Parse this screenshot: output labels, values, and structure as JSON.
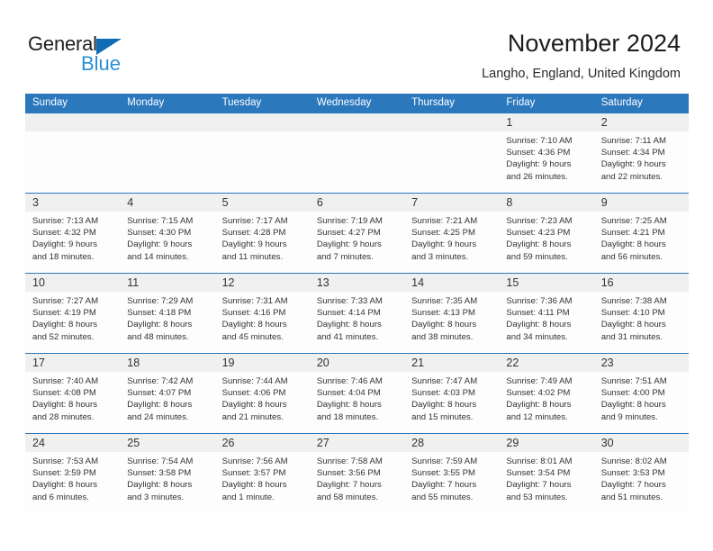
{
  "brand": {
    "name_dark": "General",
    "name_blue": "Blue",
    "dark_color": "#231f20",
    "blue_color": "#2a8fd4",
    "triangle_color": "#0f6cb5"
  },
  "header": {
    "title": "November 2024",
    "subtitle": "Langho, England, United Kingdom"
  },
  "theme": {
    "header_bg": "#2b78bd",
    "daynum_bg": "#f0f0f0",
    "cell_bg": "#fdfdfd",
    "rule_color": "#2b78bd"
  },
  "weekdays": [
    "Sunday",
    "Monday",
    "Tuesday",
    "Wednesday",
    "Thursday",
    "Friday",
    "Saturday"
  ],
  "weeks": [
    [
      {
        "day": "",
        "sunrise": "",
        "sunset": "",
        "daylight1": "",
        "daylight2": ""
      },
      {
        "day": "",
        "sunrise": "",
        "sunset": "",
        "daylight1": "",
        "daylight2": ""
      },
      {
        "day": "",
        "sunrise": "",
        "sunset": "",
        "daylight1": "",
        "daylight2": ""
      },
      {
        "day": "",
        "sunrise": "",
        "sunset": "",
        "daylight1": "",
        "daylight2": ""
      },
      {
        "day": "",
        "sunrise": "",
        "sunset": "",
        "daylight1": "",
        "daylight2": ""
      },
      {
        "day": "1",
        "sunrise": "Sunrise: 7:10 AM",
        "sunset": "Sunset: 4:36 PM",
        "daylight1": "Daylight: 9 hours",
        "daylight2": "and 26 minutes."
      },
      {
        "day": "2",
        "sunrise": "Sunrise: 7:11 AM",
        "sunset": "Sunset: 4:34 PM",
        "daylight1": "Daylight: 9 hours",
        "daylight2": "and 22 minutes."
      }
    ],
    [
      {
        "day": "3",
        "sunrise": "Sunrise: 7:13 AM",
        "sunset": "Sunset: 4:32 PM",
        "daylight1": "Daylight: 9 hours",
        "daylight2": "and 18 minutes."
      },
      {
        "day": "4",
        "sunrise": "Sunrise: 7:15 AM",
        "sunset": "Sunset: 4:30 PM",
        "daylight1": "Daylight: 9 hours",
        "daylight2": "and 14 minutes."
      },
      {
        "day": "5",
        "sunrise": "Sunrise: 7:17 AM",
        "sunset": "Sunset: 4:28 PM",
        "daylight1": "Daylight: 9 hours",
        "daylight2": "and 11 minutes."
      },
      {
        "day": "6",
        "sunrise": "Sunrise: 7:19 AM",
        "sunset": "Sunset: 4:27 PM",
        "daylight1": "Daylight: 9 hours",
        "daylight2": "and 7 minutes."
      },
      {
        "day": "7",
        "sunrise": "Sunrise: 7:21 AM",
        "sunset": "Sunset: 4:25 PM",
        "daylight1": "Daylight: 9 hours",
        "daylight2": "and 3 minutes."
      },
      {
        "day": "8",
        "sunrise": "Sunrise: 7:23 AM",
        "sunset": "Sunset: 4:23 PM",
        "daylight1": "Daylight: 8 hours",
        "daylight2": "and 59 minutes."
      },
      {
        "day": "9",
        "sunrise": "Sunrise: 7:25 AM",
        "sunset": "Sunset: 4:21 PM",
        "daylight1": "Daylight: 8 hours",
        "daylight2": "and 56 minutes."
      }
    ],
    [
      {
        "day": "10",
        "sunrise": "Sunrise: 7:27 AM",
        "sunset": "Sunset: 4:19 PM",
        "daylight1": "Daylight: 8 hours",
        "daylight2": "and 52 minutes."
      },
      {
        "day": "11",
        "sunrise": "Sunrise: 7:29 AM",
        "sunset": "Sunset: 4:18 PM",
        "daylight1": "Daylight: 8 hours",
        "daylight2": "and 48 minutes."
      },
      {
        "day": "12",
        "sunrise": "Sunrise: 7:31 AM",
        "sunset": "Sunset: 4:16 PM",
        "daylight1": "Daylight: 8 hours",
        "daylight2": "and 45 minutes."
      },
      {
        "day": "13",
        "sunrise": "Sunrise: 7:33 AM",
        "sunset": "Sunset: 4:14 PM",
        "daylight1": "Daylight: 8 hours",
        "daylight2": "and 41 minutes."
      },
      {
        "day": "14",
        "sunrise": "Sunrise: 7:35 AM",
        "sunset": "Sunset: 4:13 PM",
        "daylight1": "Daylight: 8 hours",
        "daylight2": "and 38 minutes."
      },
      {
        "day": "15",
        "sunrise": "Sunrise: 7:36 AM",
        "sunset": "Sunset: 4:11 PM",
        "daylight1": "Daylight: 8 hours",
        "daylight2": "and 34 minutes."
      },
      {
        "day": "16",
        "sunrise": "Sunrise: 7:38 AM",
        "sunset": "Sunset: 4:10 PM",
        "daylight1": "Daylight: 8 hours",
        "daylight2": "and 31 minutes."
      }
    ],
    [
      {
        "day": "17",
        "sunrise": "Sunrise: 7:40 AM",
        "sunset": "Sunset: 4:08 PM",
        "daylight1": "Daylight: 8 hours",
        "daylight2": "and 28 minutes."
      },
      {
        "day": "18",
        "sunrise": "Sunrise: 7:42 AM",
        "sunset": "Sunset: 4:07 PM",
        "daylight1": "Daylight: 8 hours",
        "daylight2": "and 24 minutes."
      },
      {
        "day": "19",
        "sunrise": "Sunrise: 7:44 AM",
        "sunset": "Sunset: 4:06 PM",
        "daylight1": "Daylight: 8 hours",
        "daylight2": "and 21 minutes."
      },
      {
        "day": "20",
        "sunrise": "Sunrise: 7:46 AM",
        "sunset": "Sunset: 4:04 PM",
        "daylight1": "Daylight: 8 hours",
        "daylight2": "and 18 minutes."
      },
      {
        "day": "21",
        "sunrise": "Sunrise: 7:47 AM",
        "sunset": "Sunset: 4:03 PM",
        "daylight1": "Daylight: 8 hours",
        "daylight2": "and 15 minutes."
      },
      {
        "day": "22",
        "sunrise": "Sunrise: 7:49 AM",
        "sunset": "Sunset: 4:02 PM",
        "daylight1": "Daylight: 8 hours",
        "daylight2": "and 12 minutes."
      },
      {
        "day": "23",
        "sunrise": "Sunrise: 7:51 AM",
        "sunset": "Sunset: 4:00 PM",
        "daylight1": "Daylight: 8 hours",
        "daylight2": "and 9 minutes."
      }
    ],
    [
      {
        "day": "24",
        "sunrise": "Sunrise: 7:53 AM",
        "sunset": "Sunset: 3:59 PM",
        "daylight1": "Daylight: 8 hours",
        "daylight2": "and 6 minutes."
      },
      {
        "day": "25",
        "sunrise": "Sunrise: 7:54 AM",
        "sunset": "Sunset: 3:58 PM",
        "daylight1": "Daylight: 8 hours",
        "daylight2": "and 3 minutes."
      },
      {
        "day": "26",
        "sunrise": "Sunrise: 7:56 AM",
        "sunset": "Sunset: 3:57 PM",
        "daylight1": "Daylight: 8 hours",
        "daylight2": "and 1 minute."
      },
      {
        "day": "27",
        "sunrise": "Sunrise: 7:58 AM",
        "sunset": "Sunset: 3:56 PM",
        "daylight1": "Daylight: 7 hours",
        "daylight2": "and 58 minutes."
      },
      {
        "day": "28",
        "sunrise": "Sunrise: 7:59 AM",
        "sunset": "Sunset: 3:55 PM",
        "daylight1": "Daylight: 7 hours",
        "daylight2": "and 55 minutes."
      },
      {
        "day": "29",
        "sunrise": "Sunrise: 8:01 AM",
        "sunset": "Sunset: 3:54 PM",
        "daylight1": "Daylight: 7 hours",
        "daylight2": "and 53 minutes."
      },
      {
        "day": "30",
        "sunrise": "Sunrise: 8:02 AM",
        "sunset": "Sunset: 3:53 PM",
        "daylight1": "Daylight: 7 hours",
        "daylight2": "and 51 minutes."
      }
    ]
  ]
}
